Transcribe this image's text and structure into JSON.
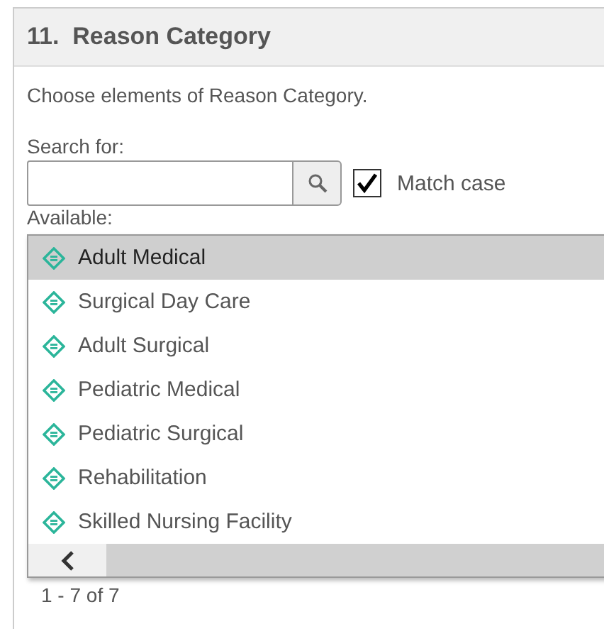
{
  "panel": {
    "title": "11.  Reason Category",
    "description": "Choose elements of Reason Category.",
    "search": {
      "label": "Search for:",
      "match_case": {
        "label": "Match case",
        "checked": true
      }
    },
    "available_label": "Available:",
    "items": [
      {
        "label": "Adult Medical",
        "selected": true
      },
      {
        "label": "Surgical Day Care",
        "selected": false
      },
      {
        "label": "Adult Surgical",
        "selected": false
      },
      {
        "label": "Pediatric Medical",
        "selected": false
      },
      {
        "label": "Pediatric Surgical",
        "selected": false
      },
      {
        "label": "Rehabilitation",
        "selected": false
      },
      {
        "label": "Skilled Nursing Facility",
        "selected": false
      }
    ],
    "count": "1 - 7 of 7"
  }
}
